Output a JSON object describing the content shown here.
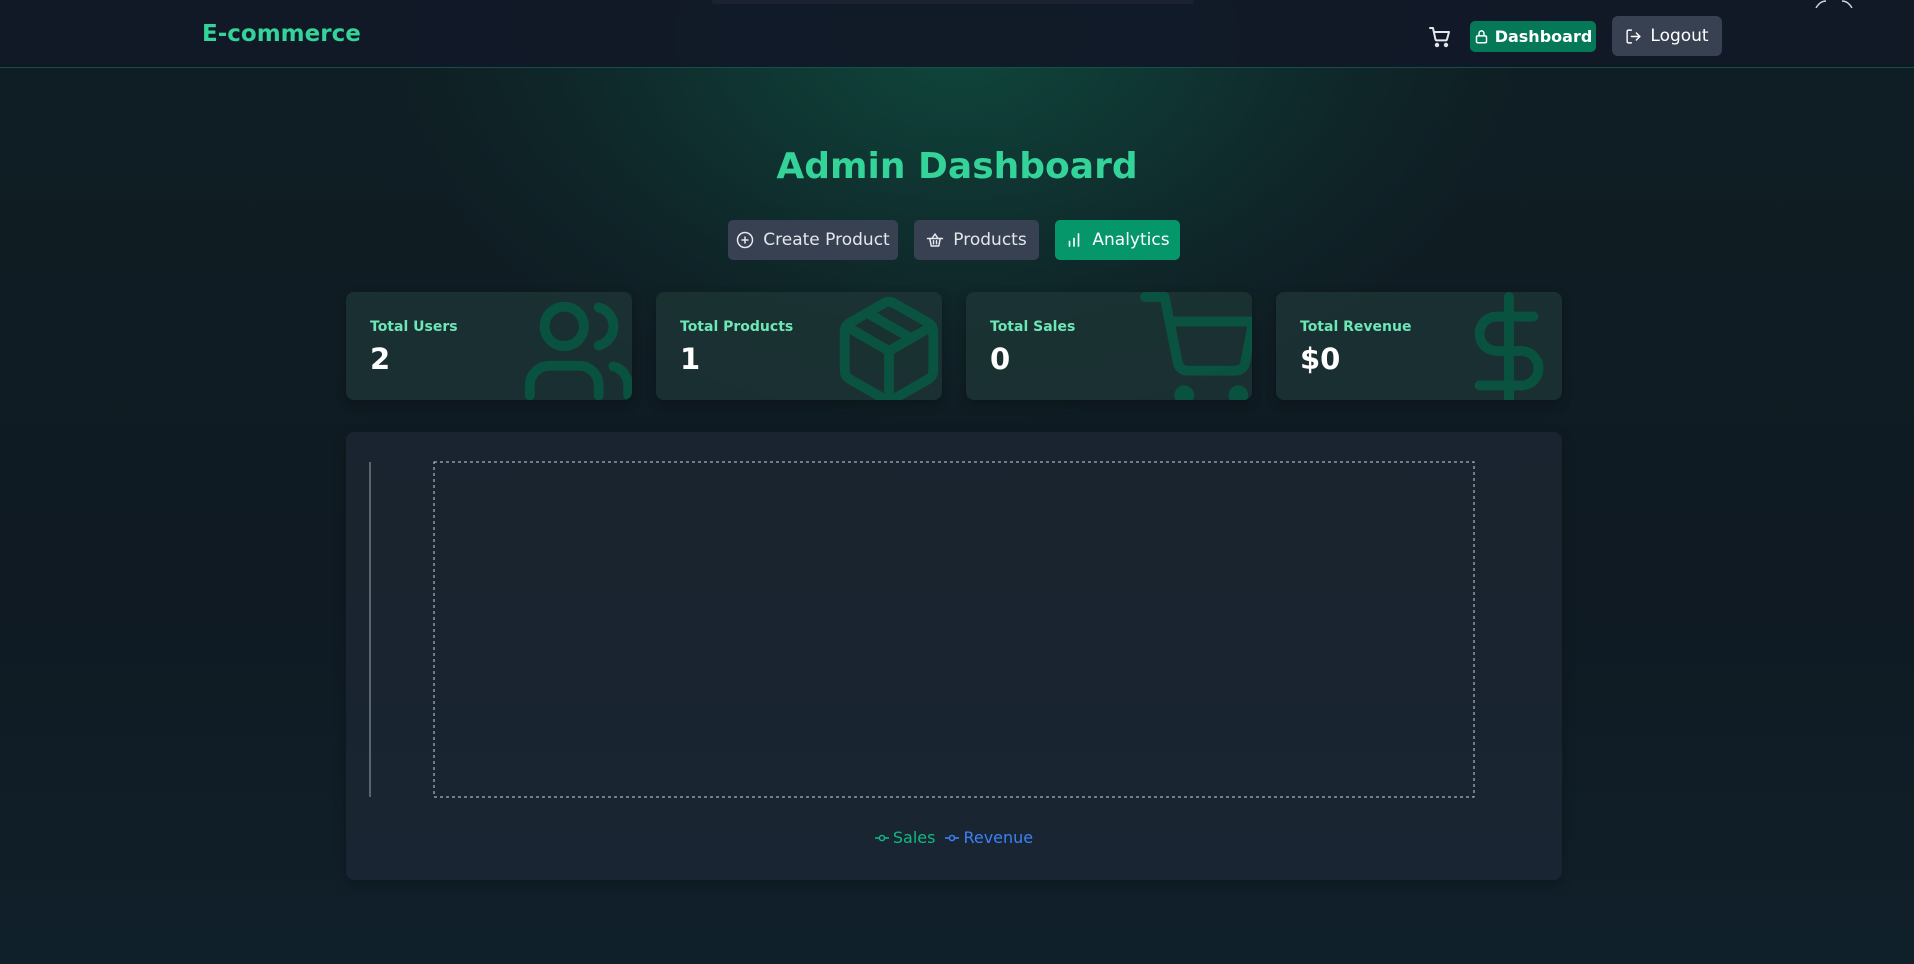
{
  "navbar": {
    "brand": "E-commerce",
    "cart_icon": "cart-icon",
    "dashboard_label": "Dashboard",
    "dashboard_icon": "lock-icon",
    "logout_label": "Logout",
    "logout_icon": "logout-icon"
  },
  "page": {
    "title": "Admin Dashboard"
  },
  "tabs": [
    {
      "label": "Create Product",
      "icon": "plus-circle-icon",
      "active": false
    },
    {
      "label": "Products",
      "icon": "basket-icon",
      "active": false
    },
    {
      "label": "Analytics",
      "icon": "bar-chart-icon",
      "active": true
    }
  ],
  "stats": [
    {
      "label": "Total Users",
      "value": "2",
      "icon": "users-icon"
    },
    {
      "label": "Total Products",
      "value": "1",
      "icon": "package-icon"
    },
    {
      "label": "Total Sales",
      "value": "0",
      "icon": "cart-icon"
    },
    {
      "label": "Total Revenue",
      "value": "$0",
      "icon": "dollar-icon"
    }
  ],
  "chart_data": {
    "type": "line",
    "x": [],
    "series": [
      {
        "name": "Sales",
        "values": [],
        "color": "#10b981"
      },
      {
        "name": "Revenue",
        "values": [],
        "color": "#3b82f6"
      }
    ],
    "grid": true,
    "legend": "bottom"
  },
  "colors": {
    "accent": "#34d399",
    "primary_button": "#059669",
    "secondary_button": "#374151",
    "sales": "#10b981",
    "revenue": "#3b82f6"
  }
}
